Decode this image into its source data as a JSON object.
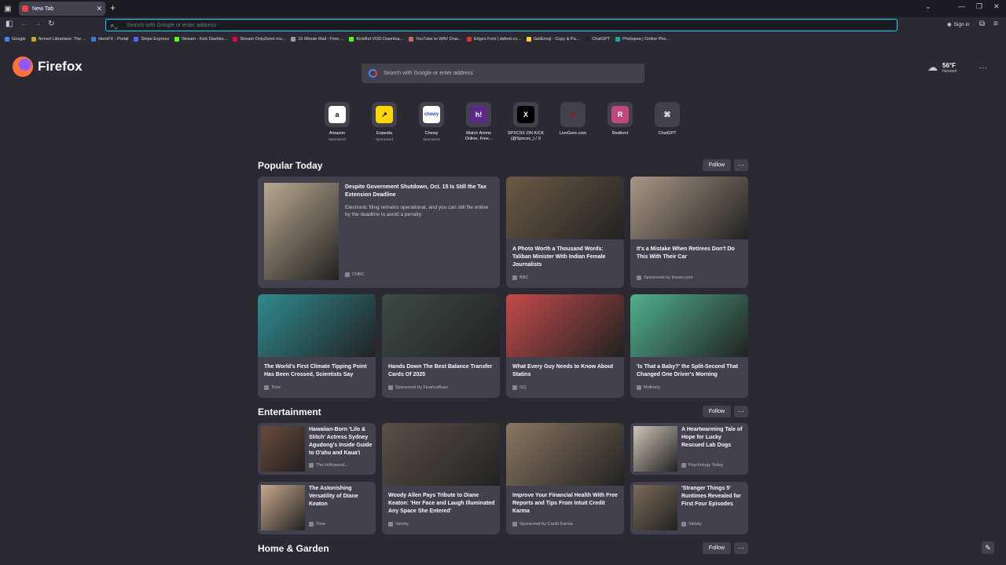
{
  "tab": {
    "title": "New Tab"
  },
  "urlbar": {
    "placeholder": "Search with Google or enter address"
  },
  "signin": "Sign in",
  "bookmarks": [
    {
      "label": "Google",
      "color": "#4285f4"
    },
    {
      "label": "Armed Librarians: The ...",
      "color": "#c9a227"
    },
    {
      "label": "HeroFX - Portal",
      "color": "#3a7bd5"
    },
    {
      "label": "Stripe Express",
      "color": "#635bff"
    },
    {
      "label": "Stream - Kick Dashbo...",
      "color": "#53fc18"
    },
    {
      "label": "Stream OnlyZenni mu...",
      "color": "#e04"
    },
    {
      "label": "10 Minute Mail - Free ...",
      "color": "#999"
    },
    {
      "label": "KickBot VOD Downloa...",
      "color": "#53fc18"
    },
    {
      "label": "YouTube to WAV Dow...",
      "color": "#c66"
    },
    {
      "label": "Edges Font | dafont.co...",
      "color": "#d33"
    },
    {
      "label": "GetEmoji - Copy & Pa...",
      "color": "#fc3"
    },
    {
      "label": "ChatGPT",
      "color": "#222"
    },
    {
      "label": "Photopea | Online Pho...",
      "color": "#18a497"
    }
  ],
  "brand": "Firefox",
  "home_search": {
    "placeholder": "Search with Google or enter address"
  },
  "weather": {
    "temp": "56°F",
    "city": "Newark"
  },
  "shortcuts": [
    {
      "label": "Amazon",
      "sub": "Sponsored",
      "glyph": "a",
      "bg": "#ffffff",
      "fg": "#111"
    },
    {
      "label": "Expedia",
      "sub": "Sponsored",
      "glyph": "↗",
      "bg": "#ffd700",
      "fg": "#000"
    },
    {
      "label": "Chewy",
      "sub": "Sponsored",
      "glyph": "chewy",
      "bg": "#ffffff",
      "fg": "#1c49c2"
    },
    {
      "label": "Watch Anime Online, Free...",
      "sub": "",
      "glyph": "h!",
      "bg": "#5b2a86",
      "fg": "#fff"
    },
    {
      "label": "SPXCSX ON KICK (@Spxcsx_) / X",
      "sub": "",
      "glyph": "X",
      "bg": "#000000",
      "fg": "#fff"
    },
    {
      "label": "LiveGore.com",
      "sub": "",
      "glyph": "●",
      "bg": "#42414d",
      "fg": "#c00"
    },
    {
      "label": "Redirect",
      "sub": "",
      "glyph": "R",
      "bg": "#c2477d",
      "fg": "#fff"
    },
    {
      "label": "ChatGPT",
      "sub": "",
      "glyph": "⌘",
      "bg": "#42414d",
      "fg": "#fff"
    }
  ],
  "sections": {
    "popular": "Popular Today",
    "entertainment": "Entertainment",
    "home": "Home & Garden",
    "follow": "Follow",
    "more": "···"
  },
  "popular_cards": [
    {
      "title": "Despite Government Shutdown, Oct. 15 Is Still the Tax Extension Deadline",
      "desc": "Electronic filing remains operational, and you can still file online by the deadline to avoid a penalty.",
      "source": "CNBC",
      "img": "#b9a88f"
    },
    {
      "title": "A Photo Worth a Thousand Words: Taliban Minister With Indian Female Journalists",
      "source": "BBC",
      "img": "#6b5a44"
    },
    {
      "title": "It's a Mistake When Retirees Don't Do This With Their Car",
      "source": "Sponsored by Insure.com",
      "img": "#a89684"
    },
    {
      "title": "The World's First Climate Tipping Point Has Been Crossed, Scientists Say",
      "source": "Time",
      "img": "#2f8a8f"
    },
    {
      "title": "Hands Down The Best Balance Transfer Cards Of 2025",
      "source": "Sponsored by FinanceBuzz",
      "img": "#3d4a45"
    },
    {
      "title": "What Every Guy Needs to Know About Statins",
      "source": "GQ",
      "img": "#c24a4a"
    },
    {
      "title": "'Is That a Baby?' the Split-Second That Changed One Driver's Morning",
      "source": "Motherly",
      "img": "#4fb08f"
    }
  ],
  "ent_cards": [
    {
      "title": "Hawaiian-Born 'Lilo & Stitch' Actress Sydney Agudong's Inside Guide to O'ahu and Kaua'i",
      "source": "The Hollywood...",
      "img": "#6b4a3a"
    },
    {
      "title": "Woody Allen Pays Tribute to Diane Keaton: 'Her Face and Laugh Illuminated Any Space She Entered'",
      "source": "Variety",
      "img": "#5a5048"
    },
    {
      "title": "Improve Your Financial Health With Free Reports and Tips From Intuit Credit Karma",
      "source": "Sponsored by Credit Karma",
      "img": "#8a7660"
    },
    {
      "title": "A Heartwarming Tale of Hope for Lucky Rescued Lab Dogs",
      "source": "Psychology Today",
      "img": "#cfc5b8"
    },
    {
      "title": "The Astonishing Versatility of Diane Keaton",
      "source": "Time",
      "img": "#c9a98c"
    },
    {
      "title": "'Stranger Things 5' Runtimes Revealed for First Four Episodes",
      "source": "Variety",
      "img": "#7a6a58"
    }
  ]
}
